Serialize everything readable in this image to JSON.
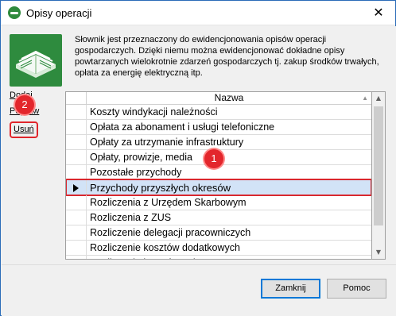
{
  "window": {
    "title": "Opisy operacji",
    "close_glyph": "✕"
  },
  "description": "Słownik jest przeznaczony do ewidencjonowania opisów operacji gospodarczych. Dzięki niemu można ewidencjonować dokładne opisy powtarzanych wielokrotnie zdarzeń gospodarczych tj. zakup środków trwałych, opłata za energię elektryczną itp.",
  "actions": {
    "add": "Dodaj",
    "edit": "Popraw",
    "delete": "Usuń"
  },
  "grid": {
    "column_header": "Nazwa",
    "rows": [
      {
        "name": "Koszty windykacji należności"
      },
      {
        "name": "Opłata za abonament i usługi telefoniczne"
      },
      {
        "name": "Opłaty za utrzymanie infrastruktury"
      },
      {
        "name": "Opłaty, prowizje, media"
      },
      {
        "name": "Pozostałe przychody"
      },
      {
        "name": "Przychody przyszłych okresów",
        "selected": true
      },
      {
        "name": "Rozliczenia z Urzędem Skarbowym"
      },
      {
        "name": "Rozliczenia z ZUS"
      },
      {
        "name": "Rozliczenie delegacji pracowniczych"
      },
      {
        "name": "Rozliczenie kosztów dodatkowych"
      },
      {
        "name": "Rozliczenie kosztów najmu"
      }
    ]
  },
  "footer": {
    "close_label": "Zamknij",
    "help_label": "Pomoc"
  },
  "badges": {
    "one": "1",
    "two": "2"
  },
  "colors": {
    "accent": "#0078d7",
    "highlight": "#e3262c",
    "selection": "#d2e3f7",
    "logo": "#2e8b3e"
  }
}
